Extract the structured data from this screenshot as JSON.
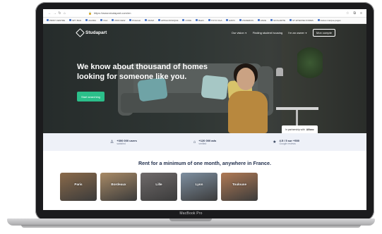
{
  "device": {
    "model": "MacBook Pro"
  },
  "browser": {
    "url": "https://www.studapart.com/en",
    "bookmarks": [
      "PRINT CENTRE",
      "SPY BAG",
      "AGORA",
      "VGA",
      "PRIX NEW",
      "Pinterest",
      "CRAM",
      "APPLE MUSIQUE",
      "CODE",
      "Batch",
      "TOYO VGA",
      "EXPO",
      "VIGNERON",
      "ANCE",
      "SCOLARITE",
      "ST ETIENNE FOIRES",
      "Autres marque-pages"
    ],
    "icons": [
      "back-icon",
      "forward-icon",
      "reload-icon",
      "home-icon",
      "lock-icon",
      "star-icon",
      "extensions-icon",
      "menu-icon"
    ]
  },
  "site": {
    "logo": "Studapart",
    "nav": {
      "our_vision": "Our vision",
      "finding": "Finding student housing",
      "owner": "I'm an owner",
      "cta": "Mon compte"
    },
    "hero": {
      "headline": "We know about thousand of homes looking for someone like you.",
      "cta": "Start searching",
      "partner_prefix": "In partnership with",
      "partner_name": "Allianz"
    },
    "stats": [
      {
        "main": "+300 000 users",
        "sub": "satisfied",
        "icon": "user-icon"
      },
      {
        "main": "+120 000 ads",
        "sub": "verified",
        "icon": "home-icon"
      },
      {
        "main": "4.5 / 5 sur +500",
        "sub": "Google reviews",
        "icon": "star-icon"
      }
    ],
    "tagline": "Rent for a minimum of one month, anywhere in France.",
    "cities": [
      {
        "name": "Paris",
        "color": "#8a6a4a"
      },
      {
        "name": "Bordeaux",
        "color": "#a88a66"
      },
      {
        "name": "Lille",
        "color": "#6f6a6a"
      },
      {
        "name": "Lyon",
        "color": "#7e8fa0"
      },
      {
        "name": "Toulouse",
        "color": "#b07a55"
      }
    ]
  }
}
